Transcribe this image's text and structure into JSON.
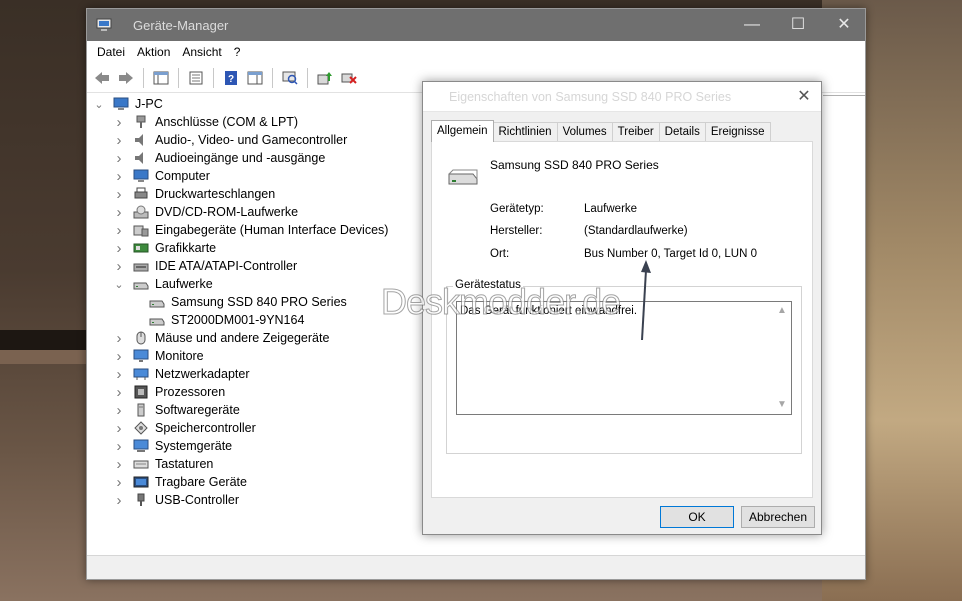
{
  "device_manager": {
    "title": "Geräte-Manager",
    "menu": [
      "Datei",
      "Aktion",
      "Ansicht",
      "?"
    ],
    "tree": {
      "root": "J-PC",
      "categories": [
        {
          "label": "Anschlüsse (COM & LPT)",
          "icon": "port-icon"
        },
        {
          "label": "Audio-, Video- und Gamecontroller",
          "icon": "speaker-icon"
        },
        {
          "label": "Audioeingänge und -ausgänge",
          "icon": "speaker-icon"
        },
        {
          "label": "Computer",
          "icon": "computer-icon"
        },
        {
          "label": "Druckwarteschlangen",
          "icon": "printer-icon"
        },
        {
          "label": "DVD/CD-ROM-Laufwerke",
          "icon": "dvd-icon"
        },
        {
          "label": "Eingabegeräte (Human Interface Devices)",
          "icon": "hid-icon"
        },
        {
          "label": "Grafikkarte",
          "icon": "graphics-card-icon"
        },
        {
          "label": "IDE ATA/ATAPI-Controller",
          "icon": "ide-controller-icon"
        },
        {
          "label": "Laufwerke",
          "icon": "drive-icon",
          "expanded": true,
          "children": [
            "Samsung SSD 840 PRO Series",
            "ST2000DM001-9YN164"
          ]
        },
        {
          "label": "Mäuse und andere Zeigegeräte",
          "icon": "mouse-icon"
        },
        {
          "label": "Monitore",
          "icon": "monitor-icon"
        },
        {
          "label": "Netzwerkadapter",
          "icon": "network-icon"
        },
        {
          "label": "Prozessoren",
          "icon": "cpu-icon"
        },
        {
          "label": "Softwaregeräte",
          "icon": "software-device-icon"
        },
        {
          "label": "Speichercontroller",
          "icon": "storage-controller-icon"
        },
        {
          "label": "Systemgeräte",
          "icon": "system-device-icon"
        },
        {
          "label": "Tastaturen",
          "icon": "keyboard-icon"
        },
        {
          "label": "Tragbare Geräte",
          "icon": "portable-device-icon"
        },
        {
          "label": "USB-Controller",
          "icon": "usb-icon"
        }
      ]
    }
  },
  "dialog": {
    "title": "Eigenschaften von Samsung SSD 840 PRO Series",
    "tabs": [
      "Allgemein",
      "Richtlinien",
      "Volumes",
      "Treiber",
      "Details",
      "Ereignisse"
    ],
    "active_tab": "Allgemein",
    "device_name": "Samsung SSD 840 PRO Series",
    "properties": [
      {
        "label": "Gerätetyp:",
        "value": "Laufwerke"
      },
      {
        "label": "Hersteller:",
        "value": "(Standardlaufwerke)"
      },
      {
        "label": "Ort:",
        "value": "Bus Number 0, Target Id 0, LUN 0"
      }
    ],
    "status_group_title": "Gerätestatus",
    "status_text": "Das Gerät funktioniert einwandfrei.",
    "ok_label": "OK",
    "cancel_label": "Abbrechen"
  },
  "watermark": "Deskmodder.de",
  "colors": {
    "titlebar": "#6f6f6f",
    "window_bg": "#ffffff",
    "dialog_bg": "#f0f0f0",
    "accent_blue": "#1e6fd9"
  }
}
